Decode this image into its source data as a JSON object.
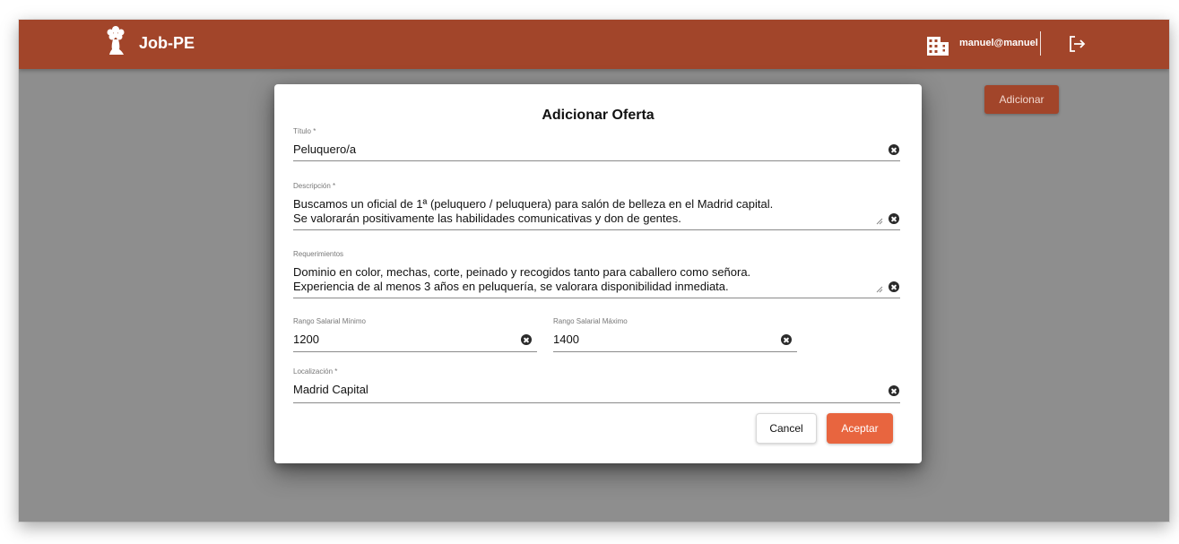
{
  "app": {
    "name": "Job-PE",
    "user_email": "manuel@manuel",
    "icons": {
      "brand": "tree-head-logo-icon",
      "building": "building-icon",
      "logout": "logout-icon"
    }
  },
  "page": {
    "add_button_label": "Adicionar"
  },
  "modal": {
    "title": "Adicionar Oferta",
    "fields": {
      "titulo": {
        "label": "Título *",
        "value": "Peluquero/a"
      },
      "descripcion": {
        "label": "Descripción *",
        "lines": [
          "Buscamos un oficial de 1ª (peluquero / peluquera) para salón de belleza en el Madrid capital.",
          "Se valorarán positivamente las habilidades comunicativas y don de gentes."
        ]
      },
      "requerimientos": {
        "label": "Requerimientos",
        "lines": [
          "Dominio en color, mechas, corte, peinado y recogidos tanto para caballero como señora.",
          "Experiencia de al menos 3 años en peluquería, se valorara disponibilidad inmediata."
        ]
      },
      "salario_min": {
        "label": "Rango Salarial Mínimo",
        "value": "1200"
      },
      "salario_max": {
        "label": "Rango Salarial Máximo",
        "value": "1400"
      },
      "localizacion": {
        "label": "Localización *",
        "value": "Madrid Capital"
      }
    },
    "buttons": {
      "cancel": "Cancel",
      "accept": "Aceptar"
    }
  },
  "colors": {
    "header": "#a2452a",
    "accent": "#e8653f",
    "backdrop": "#8e8e8e"
  }
}
